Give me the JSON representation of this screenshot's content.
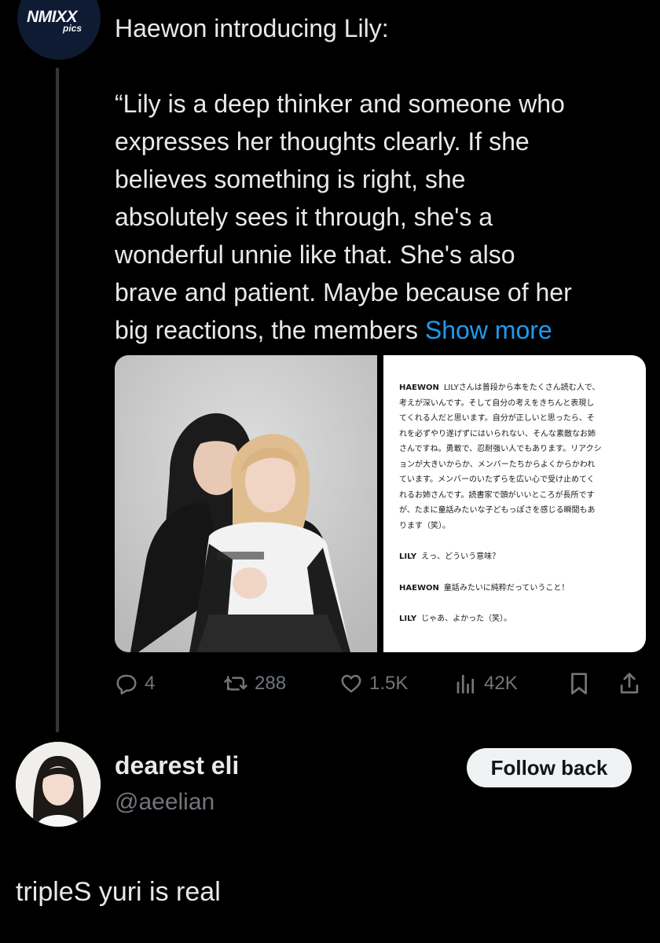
{
  "parent_tweet": {
    "avatar": {
      "logo_main": "NMIXX",
      "logo_sub": "pics",
      "background": "#0e1b33"
    },
    "intro": "Haewon introducing Lily:",
    "quote_lines": [
      "“Lily is a deep thinker and someone who",
      "expresses her thoughts clearly. If she",
      "believes something is right, she",
      "absolutely sees it through, she's a",
      "wonderful unnie like that. She's also",
      "brave and patient. Maybe because of her"
    ],
    "last_line": "big reactions, the members",
    "show_more": "Show more",
    "media": {
      "photo_icon": "photo-of-two-members",
      "scan": {
        "p1_speaker": "HAEWON",
        "p1_lines": [
          "LILYさんは普段から本をたくさん読む人で、",
          "考えが深いんです。そして自分の考えをきちんと表現し",
          "てくれる人だと思います。自分が正しいと思ったら、そ",
          "れを必ずやり遂げずにはいられない、そんな素敵なお姉",
          "さんですね。勇敢で、忍耐強い人でもあります。リアクシ",
          "ョンが大きいからか、メンバーたちからよくからかわれ",
          "ています。メンバーのいたずらを広い心で受け止めてく",
          "れるお姉さんです。読書家で頭がいいところが長所です",
          "が、たまに童話みたいな子どもっぽさを感じる瞬間もあ",
          "ります（笑）。"
        ],
        "p2_speaker": "LILY",
        "p2_text": "えっ、どういう意味？",
        "p3_speaker": "HAEWON",
        "p3_text": "童話みたいに純粋だっていうこと！",
        "p4_speaker": "LILY",
        "p4_text": "じゃあ、よかった（笑）。"
      }
    },
    "actions": {
      "replies": "4",
      "retweets": "288",
      "likes": "1.5K",
      "views": "42K"
    },
    "accent_color": "#1d9bf0"
  },
  "reply": {
    "name": "dearest eli",
    "handle": "@aeelian",
    "follow_label": "Follow back",
    "text": "tripleS yuri is real"
  }
}
